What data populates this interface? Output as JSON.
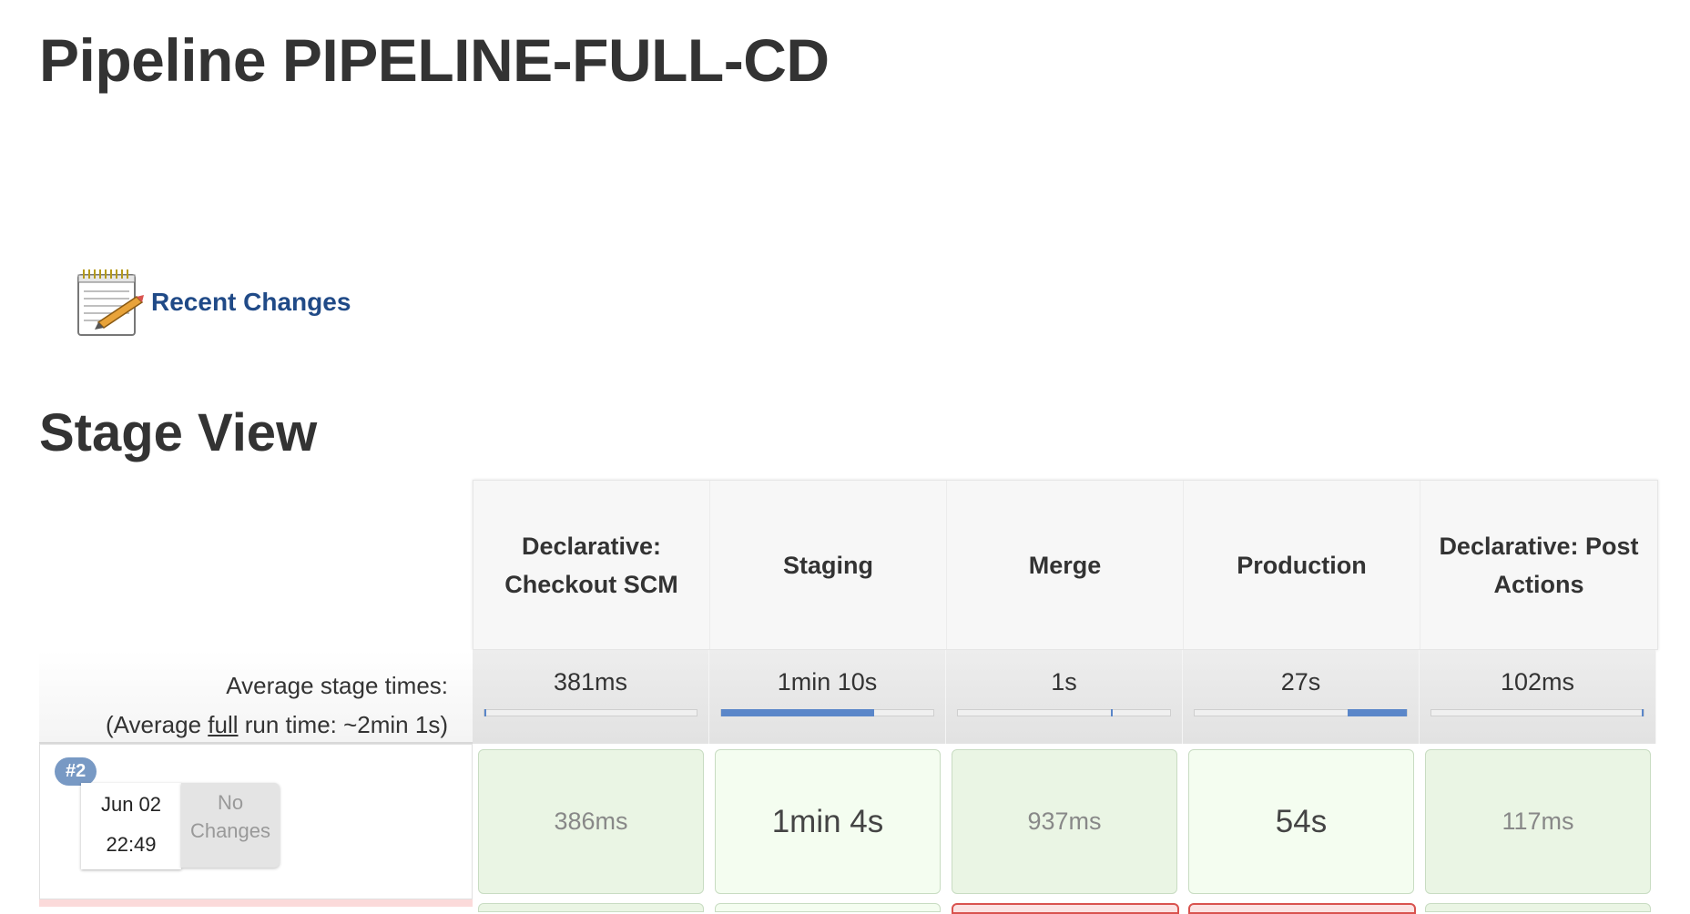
{
  "page": {
    "title": "Pipeline PIPELINE-FULL-CD",
    "recent_changes": "Recent Changes",
    "section_title": "Stage View"
  },
  "stage_view": {
    "stages": [
      {
        "name": "Declarative: Checkout SCM",
        "avg": "381ms",
        "bar_start": 0.0,
        "bar_fraction": 0.003
      },
      {
        "name": "Staging",
        "avg": "1min 10s",
        "bar_start": 0.0,
        "bar_fraction": 0.72
      },
      {
        "name": "Merge",
        "avg": "1s",
        "bar_start": 0.72,
        "bar_fraction": 0.01
      },
      {
        "name": "Production",
        "avg": "27s",
        "bar_start": 0.72,
        "bar_fraction": 0.28
      },
      {
        "name": "Declarative: Post Actions",
        "avg": "102ms",
        "bar_start": 0.99,
        "bar_fraction": 0.01
      }
    ],
    "avg_label": "Average stage times:",
    "avg_run_prefix": "(Average ",
    "avg_run_full": "full",
    "avg_run_suffix": " run time: ~2min 1s)",
    "runs": [
      {
        "badge": "#2",
        "date": "Jun 02",
        "time": "22:49",
        "changes": "No Changes",
        "cells": [
          "386ms",
          "1min 4s",
          "937ms",
          "54s",
          "117ms"
        ]
      }
    ]
  },
  "colors": {
    "link": "#204a87",
    "success_cell": "#eaf5e4",
    "failed_row": "#fbdada",
    "bar": "#5a86c9"
  }
}
